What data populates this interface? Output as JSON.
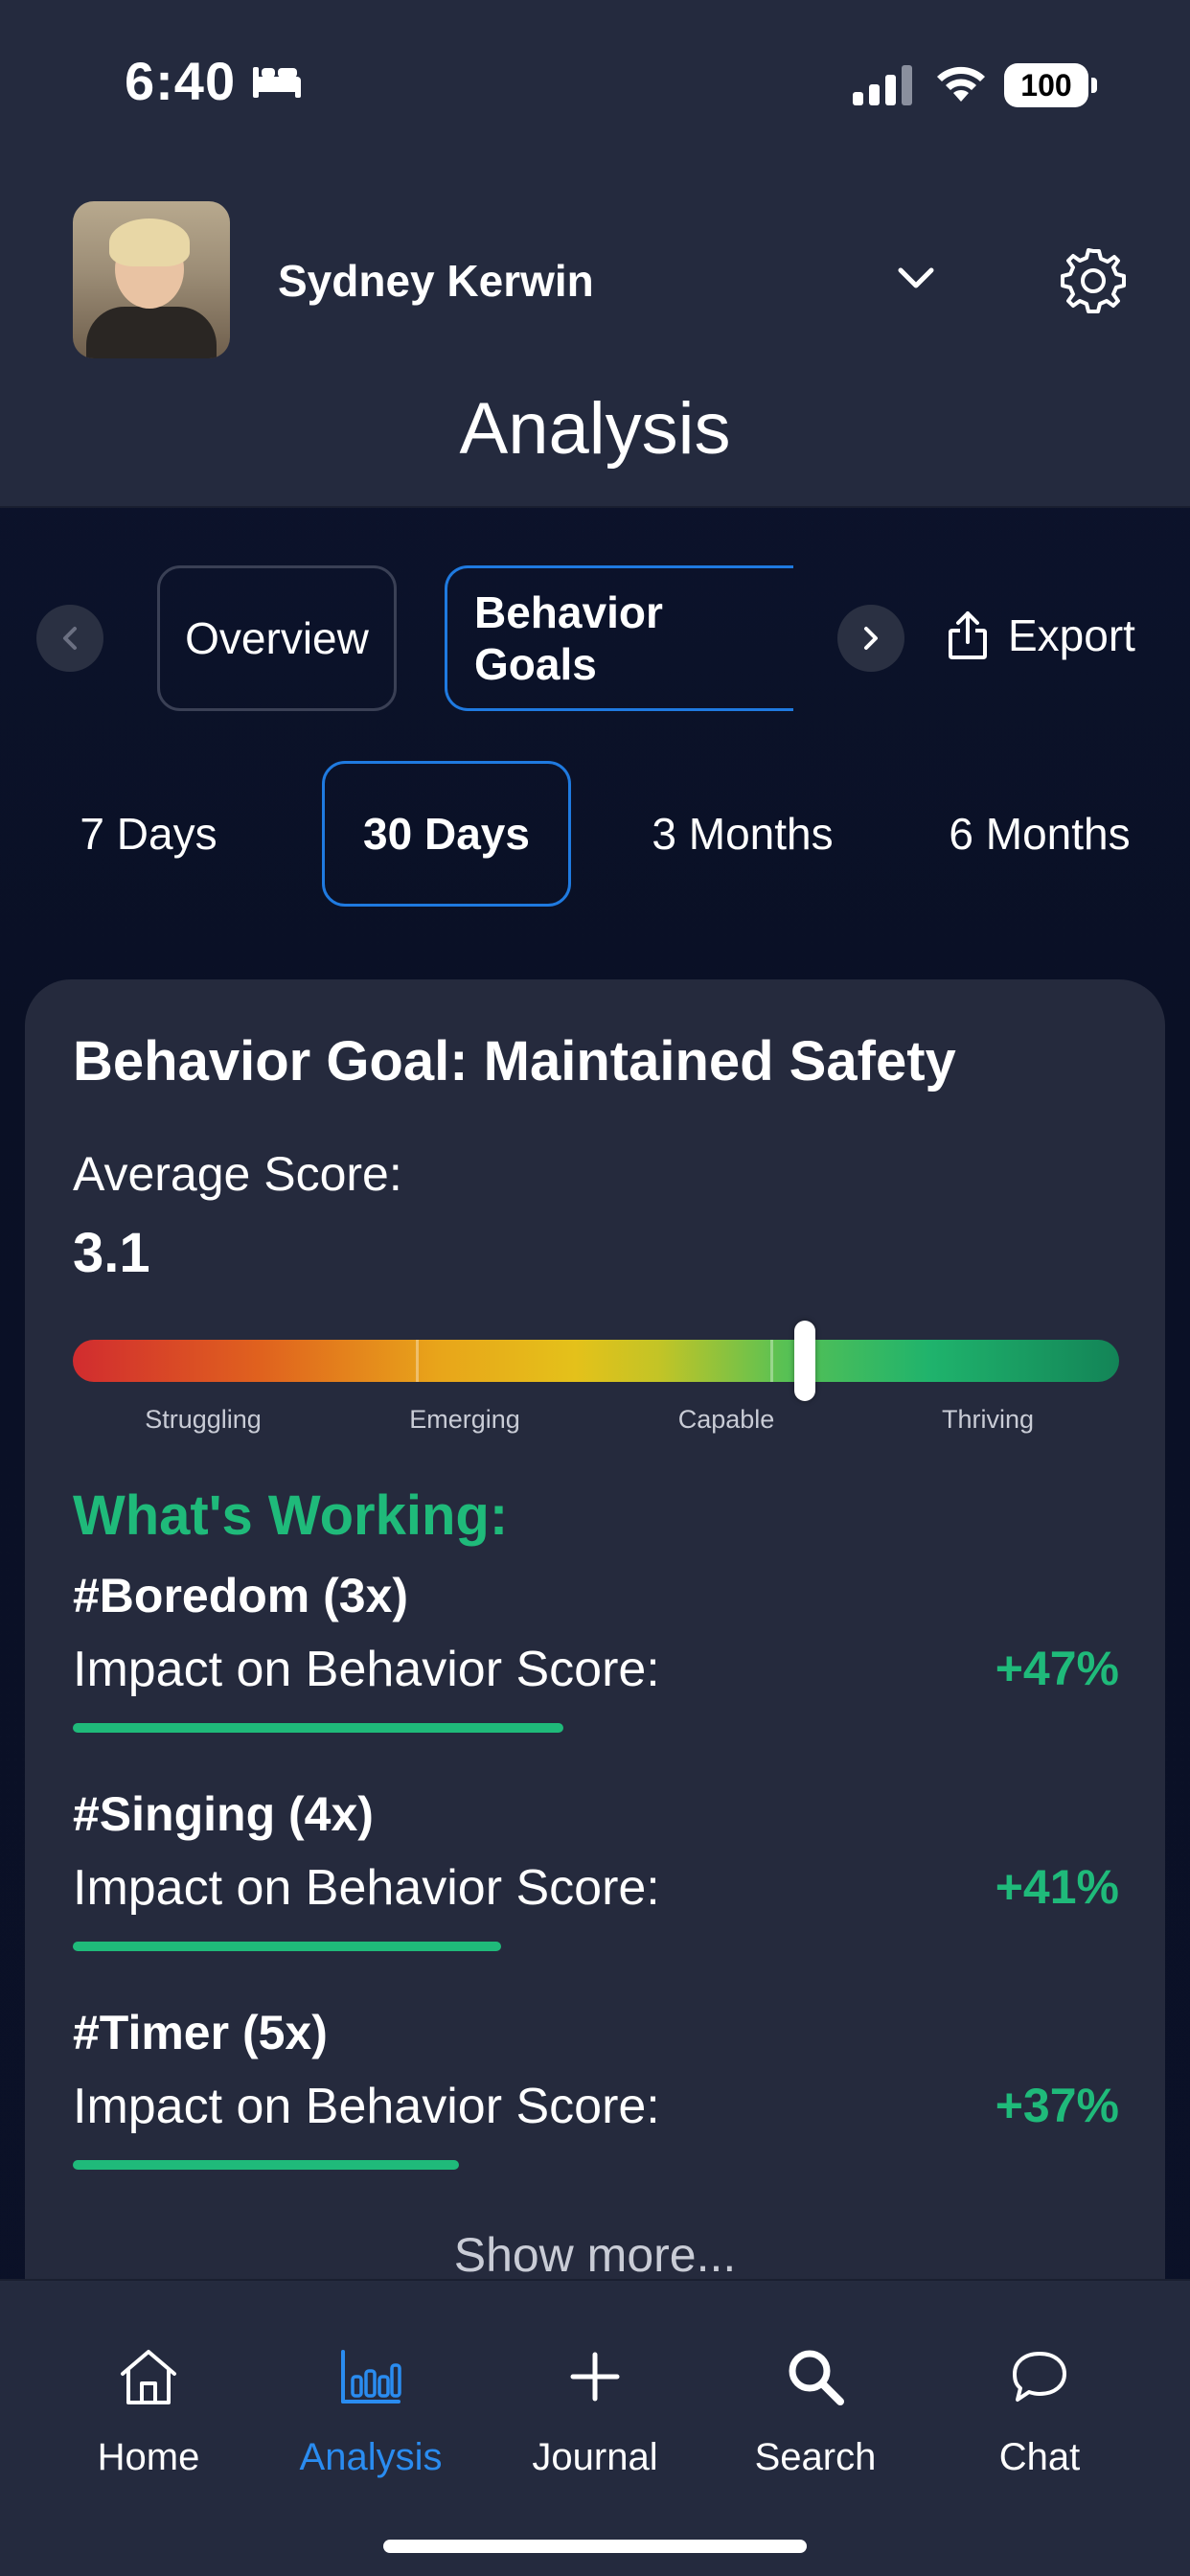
{
  "status_bar": {
    "time": "6:40",
    "battery": "100"
  },
  "header": {
    "user_name": "Sydney Kerwin",
    "title": "Analysis"
  },
  "tabs": {
    "items": [
      "Overview",
      "Behavior Goals"
    ],
    "active": "Behavior Goals",
    "export_label": "Export"
  },
  "ranges": {
    "items": [
      "7 Days",
      "30 Days",
      "3 Months",
      "6 Months"
    ],
    "active": "30 Days"
  },
  "card": {
    "title": "Behavior Goal: Maintained Safety",
    "average_label": "Average Score:",
    "average_value": "3.1",
    "scale": {
      "labels": [
        "Struggling",
        "Emerging",
        "Capable",
        "Thriving"
      ],
      "marker_fraction": 0.7,
      "colors": [
        "#d12c2f",
        "#e0621e",
        "#e8a51a",
        "#e4c11a",
        "#58c154",
        "#1fb36c",
        "#138457"
      ]
    },
    "working_title": "What's Working:",
    "items": [
      {
        "tag": "#Boredom (3x)",
        "impact_label": "Impact on Behavior Score:",
        "impact_value": "+47%",
        "impact": 47
      },
      {
        "tag": "#Singing (4x)",
        "impact_label": "Impact on Behavior Score:",
        "impact_value": "+41%",
        "impact": 41
      },
      {
        "tag": "#Timer (5x)",
        "impact_label": "Impact on Behavior Score:",
        "impact_value": "+37%",
        "impact": 37
      }
    ],
    "show_more": "Show more..."
  },
  "tabbar": {
    "items": [
      {
        "label": "Home",
        "icon": "home-icon"
      },
      {
        "label": "Analysis",
        "icon": "bar-chart-icon"
      },
      {
        "label": "Journal",
        "icon": "plus-icon"
      },
      {
        "label": "Search",
        "icon": "search-icon"
      },
      {
        "label": "Chat",
        "icon": "chat-icon"
      }
    ],
    "active": "Analysis"
  },
  "colors": {
    "accent_blue": "#1f7ae0",
    "positive_green": "#1fba7a",
    "header_bg": "#242a3e",
    "card_bg": "#252a3d"
  }
}
